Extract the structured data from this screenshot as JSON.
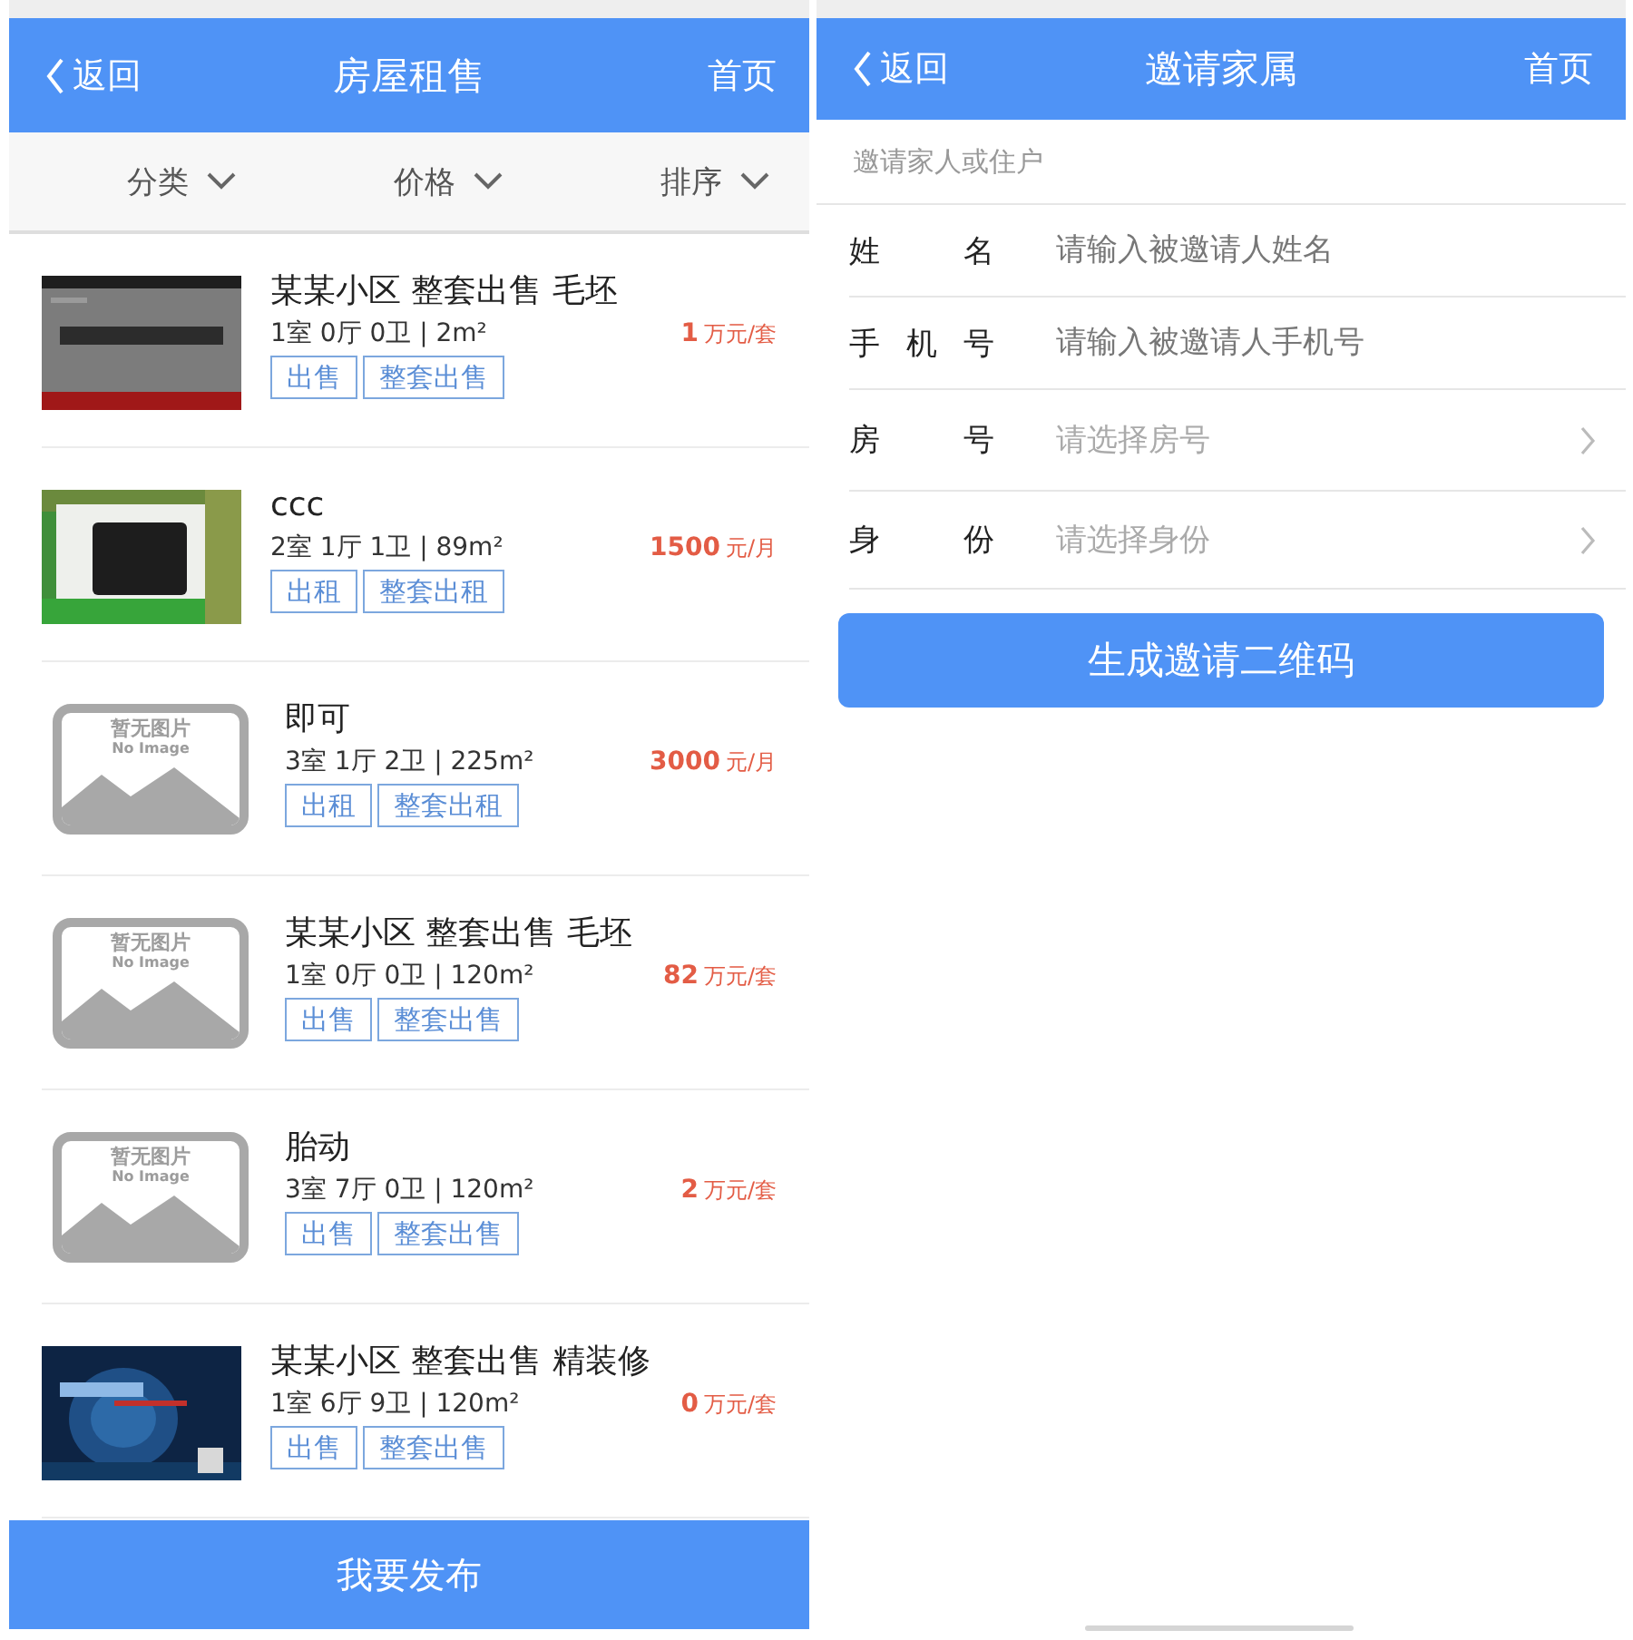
{
  "rent_screen": {
    "header": {
      "back": "返回",
      "title": "房屋租售",
      "home": "首页"
    },
    "filters": [
      {
        "label": "分类"
      },
      {
        "label": "价格"
      },
      {
        "label": "排序"
      }
    ],
    "listings": [
      {
        "thumbnail": {
          "kind": "picture"
        },
        "title": "某某小区 整套出售 毛坯",
        "details": "1室 0厅 0卫 | 2m²",
        "price": "1",
        "unit": "万元/套",
        "tags": [
          "出售",
          "整套出售"
        ]
      },
      {
        "thumbnail": {
          "kind": "picture"
        },
        "title": "ccc",
        "details": "2室 1厅 1卫 | 89m²",
        "price": "1500",
        "unit": "元/月",
        "tags": [
          "出租",
          "整套出租"
        ]
      },
      {
        "thumbnail": {
          "kind": "placeholder",
          "text": "暂无图片",
          "subtext": "No Image"
        },
        "title": "即可",
        "details": "3室 1厅 2卫 | 225m²",
        "price": "3000",
        "unit": "元/月",
        "tags": [
          "出租",
          "整套出租"
        ]
      },
      {
        "thumbnail": {
          "kind": "placeholder",
          "text": "暂无图片",
          "subtext": "No Image"
        },
        "title": "某某小区 整套出售 毛坯",
        "details": "1室 0厅 0卫 | 120m²",
        "price": "82",
        "unit": "万元/套",
        "tags": [
          "出售",
          "整套出售"
        ]
      },
      {
        "thumbnail": {
          "kind": "placeholder",
          "text": "暂无图片",
          "subtext": "No Image"
        },
        "title": "胎动",
        "details": "3室 7厅 0卫 | 120m²",
        "price": "2",
        "unit": "万元/套",
        "tags": [
          "出售",
          "整套出售"
        ]
      },
      {
        "thumbnail": {
          "kind": "picture"
        },
        "title": "某某小区 整套出售 精装修",
        "details": "1室 6厅 9卫 | 120m²",
        "price": "0",
        "unit": "万元/套",
        "tags": [
          "出售",
          "整套出售"
        ]
      }
    ],
    "publish_button": "我要发布"
  },
  "invite_screen": {
    "header": {
      "back": "返回",
      "title": "邀请家属",
      "home": "首页"
    },
    "section_label": "邀请家人或住户",
    "fields": [
      {
        "kind": "input",
        "label": "姓名",
        "placeholder": "请输入被邀请人姓名"
      },
      {
        "kind": "input",
        "label": "手机号",
        "placeholder": "请输入被邀请人手机号"
      },
      {
        "kind": "select",
        "label": "房号",
        "placeholder": "请选择房号"
      },
      {
        "kind": "select",
        "label": "身份",
        "placeholder": "请选择身份"
      }
    ],
    "submit_button": "生成邀请二维码"
  }
}
